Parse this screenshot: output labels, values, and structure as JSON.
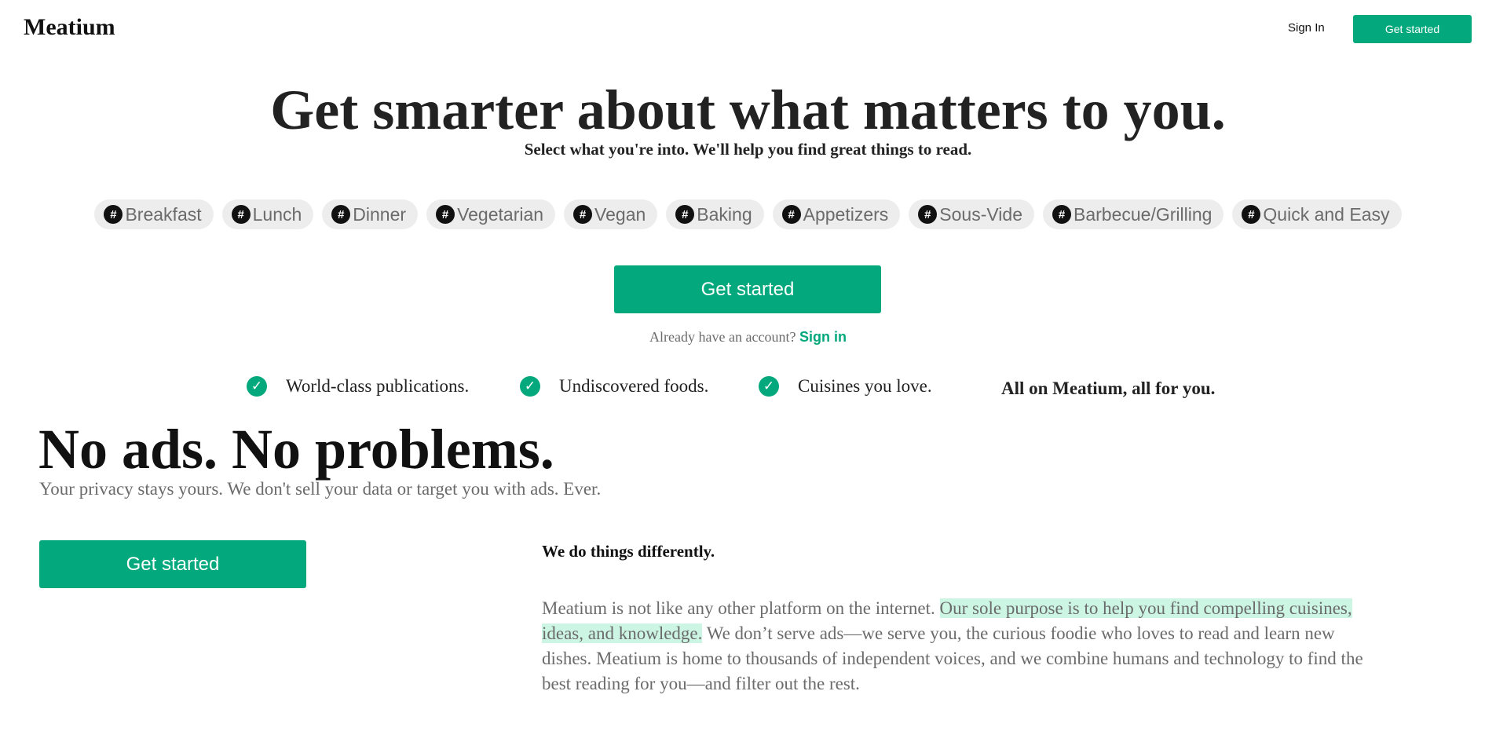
{
  "header": {
    "logo": "Meatium",
    "sign_in": "Sign In",
    "get_started": "Get started"
  },
  "hero": {
    "title": "Get smarter about what matters to you.",
    "subtitle": "Select what you're into. We'll help you find great things to read.",
    "tags": [
      "Breakfast",
      "Lunch",
      "Dinner",
      "Vegetarian",
      "Vegan",
      "Baking",
      "Appetizers",
      "Sous-Vide",
      "Barbecue/Grilling",
      "Quick and Easy"
    ],
    "hash_symbol": "#",
    "cta": "Get started",
    "already_text": "Already have an account?",
    "sign_in_link": "Sign in"
  },
  "features": {
    "items": [
      "World-class publications.",
      "Undiscovered foods.",
      "Cuisines you love."
    ],
    "check_glyph": "✓",
    "tagline": "All on Meatium, all for you."
  },
  "privacy": {
    "title": "No ads. No problems.",
    "subtitle": "Your privacy stays yours. We don't sell your data or target you with ads. Ever.",
    "cta": "Get started"
  },
  "different": {
    "title": "We do things differently.",
    "body_before": "Meatium is not like any other platform on the internet. ",
    "body_highlight": "Our sole purpose is to help you find compelling cuisines, ideas, and knowledge.",
    "body_after": " We don’t serve ads—we serve you, the curious foodie who loves to read and learn new dishes. Meatium is home to thousands of independent voices, and we combine humans and technology to find the best reading for you—and filter out the rest."
  },
  "colors": {
    "accent": "#03a87c",
    "highlight": "#ccf5e4",
    "tag_bg": "#ededed",
    "muted_text": "#6b6b6b"
  }
}
